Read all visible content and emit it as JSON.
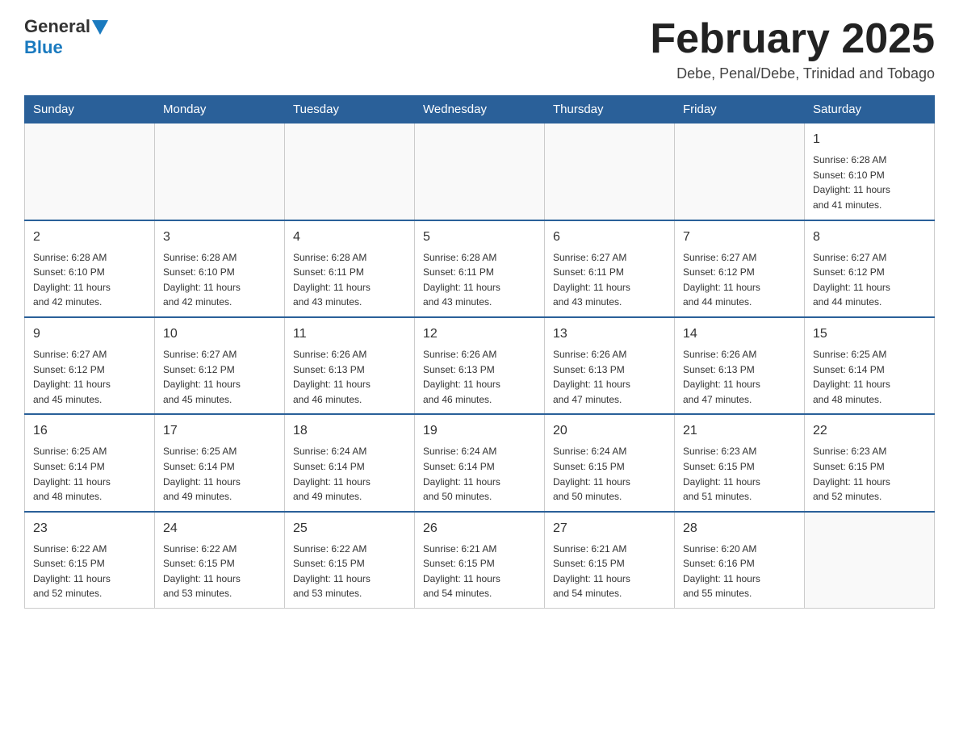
{
  "header": {
    "logo_general": "General",
    "logo_blue": "Blue",
    "title": "February 2025",
    "subtitle": "Debe, Penal/Debe, Trinidad and Tobago"
  },
  "weekdays": [
    "Sunday",
    "Monday",
    "Tuesday",
    "Wednesday",
    "Thursday",
    "Friday",
    "Saturday"
  ],
  "weeks": [
    [
      {
        "day": "",
        "info": ""
      },
      {
        "day": "",
        "info": ""
      },
      {
        "day": "",
        "info": ""
      },
      {
        "day": "",
        "info": ""
      },
      {
        "day": "",
        "info": ""
      },
      {
        "day": "",
        "info": ""
      },
      {
        "day": "1",
        "info": "Sunrise: 6:28 AM\nSunset: 6:10 PM\nDaylight: 11 hours\nand 41 minutes."
      }
    ],
    [
      {
        "day": "2",
        "info": "Sunrise: 6:28 AM\nSunset: 6:10 PM\nDaylight: 11 hours\nand 42 minutes."
      },
      {
        "day": "3",
        "info": "Sunrise: 6:28 AM\nSunset: 6:10 PM\nDaylight: 11 hours\nand 42 minutes."
      },
      {
        "day": "4",
        "info": "Sunrise: 6:28 AM\nSunset: 6:11 PM\nDaylight: 11 hours\nand 43 minutes."
      },
      {
        "day": "5",
        "info": "Sunrise: 6:28 AM\nSunset: 6:11 PM\nDaylight: 11 hours\nand 43 minutes."
      },
      {
        "day": "6",
        "info": "Sunrise: 6:27 AM\nSunset: 6:11 PM\nDaylight: 11 hours\nand 43 minutes."
      },
      {
        "day": "7",
        "info": "Sunrise: 6:27 AM\nSunset: 6:12 PM\nDaylight: 11 hours\nand 44 minutes."
      },
      {
        "day": "8",
        "info": "Sunrise: 6:27 AM\nSunset: 6:12 PM\nDaylight: 11 hours\nand 44 minutes."
      }
    ],
    [
      {
        "day": "9",
        "info": "Sunrise: 6:27 AM\nSunset: 6:12 PM\nDaylight: 11 hours\nand 45 minutes."
      },
      {
        "day": "10",
        "info": "Sunrise: 6:27 AM\nSunset: 6:12 PM\nDaylight: 11 hours\nand 45 minutes."
      },
      {
        "day": "11",
        "info": "Sunrise: 6:26 AM\nSunset: 6:13 PM\nDaylight: 11 hours\nand 46 minutes."
      },
      {
        "day": "12",
        "info": "Sunrise: 6:26 AM\nSunset: 6:13 PM\nDaylight: 11 hours\nand 46 minutes."
      },
      {
        "day": "13",
        "info": "Sunrise: 6:26 AM\nSunset: 6:13 PM\nDaylight: 11 hours\nand 47 minutes."
      },
      {
        "day": "14",
        "info": "Sunrise: 6:26 AM\nSunset: 6:13 PM\nDaylight: 11 hours\nand 47 minutes."
      },
      {
        "day": "15",
        "info": "Sunrise: 6:25 AM\nSunset: 6:14 PM\nDaylight: 11 hours\nand 48 minutes."
      }
    ],
    [
      {
        "day": "16",
        "info": "Sunrise: 6:25 AM\nSunset: 6:14 PM\nDaylight: 11 hours\nand 48 minutes."
      },
      {
        "day": "17",
        "info": "Sunrise: 6:25 AM\nSunset: 6:14 PM\nDaylight: 11 hours\nand 49 minutes."
      },
      {
        "day": "18",
        "info": "Sunrise: 6:24 AM\nSunset: 6:14 PM\nDaylight: 11 hours\nand 49 minutes."
      },
      {
        "day": "19",
        "info": "Sunrise: 6:24 AM\nSunset: 6:14 PM\nDaylight: 11 hours\nand 50 minutes."
      },
      {
        "day": "20",
        "info": "Sunrise: 6:24 AM\nSunset: 6:15 PM\nDaylight: 11 hours\nand 50 minutes."
      },
      {
        "day": "21",
        "info": "Sunrise: 6:23 AM\nSunset: 6:15 PM\nDaylight: 11 hours\nand 51 minutes."
      },
      {
        "day": "22",
        "info": "Sunrise: 6:23 AM\nSunset: 6:15 PM\nDaylight: 11 hours\nand 52 minutes."
      }
    ],
    [
      {
        "day": "23",
        "info": "Sunrise: 6:22 AM\nSunset: 6:15 PM\nDaylight: 11 hours\nand 52 minutes."
      },
      {
        "day": "24",
        "info": "Sunrise: 6:22 AM\nSunset: 6:15 PM\nDaylight: 11 hours\nand 53 minutes."
      },
      {
        "day": "25",
        "info": "Sunrise: 6:22 AM\nSunset: 6:15 PM\nDaylight: 11 hours\nand 53 minutes."
      },
      {
        "day": "26",
        "info": "Sunrise: 6:21 AM\nSunset: 6:15 PM\nDaylight: 11 hours\nand 54 minutes."
      },
      {
        "day": "27",
        "info": "Sunrise: 6:21 AM\nSunset: 6:15 PM\nDaylight: 11 hours\nand 54 minutes."
      },
      {
        "day": "28",
        "info": "Sunrise: 6:20 AM\nSunset: 6:16 PM\nDaylight: 11 hours\nand 55 minutes."
      },
      {
        "day": "",
        "info": ""
      }
    ]
  ]
}
